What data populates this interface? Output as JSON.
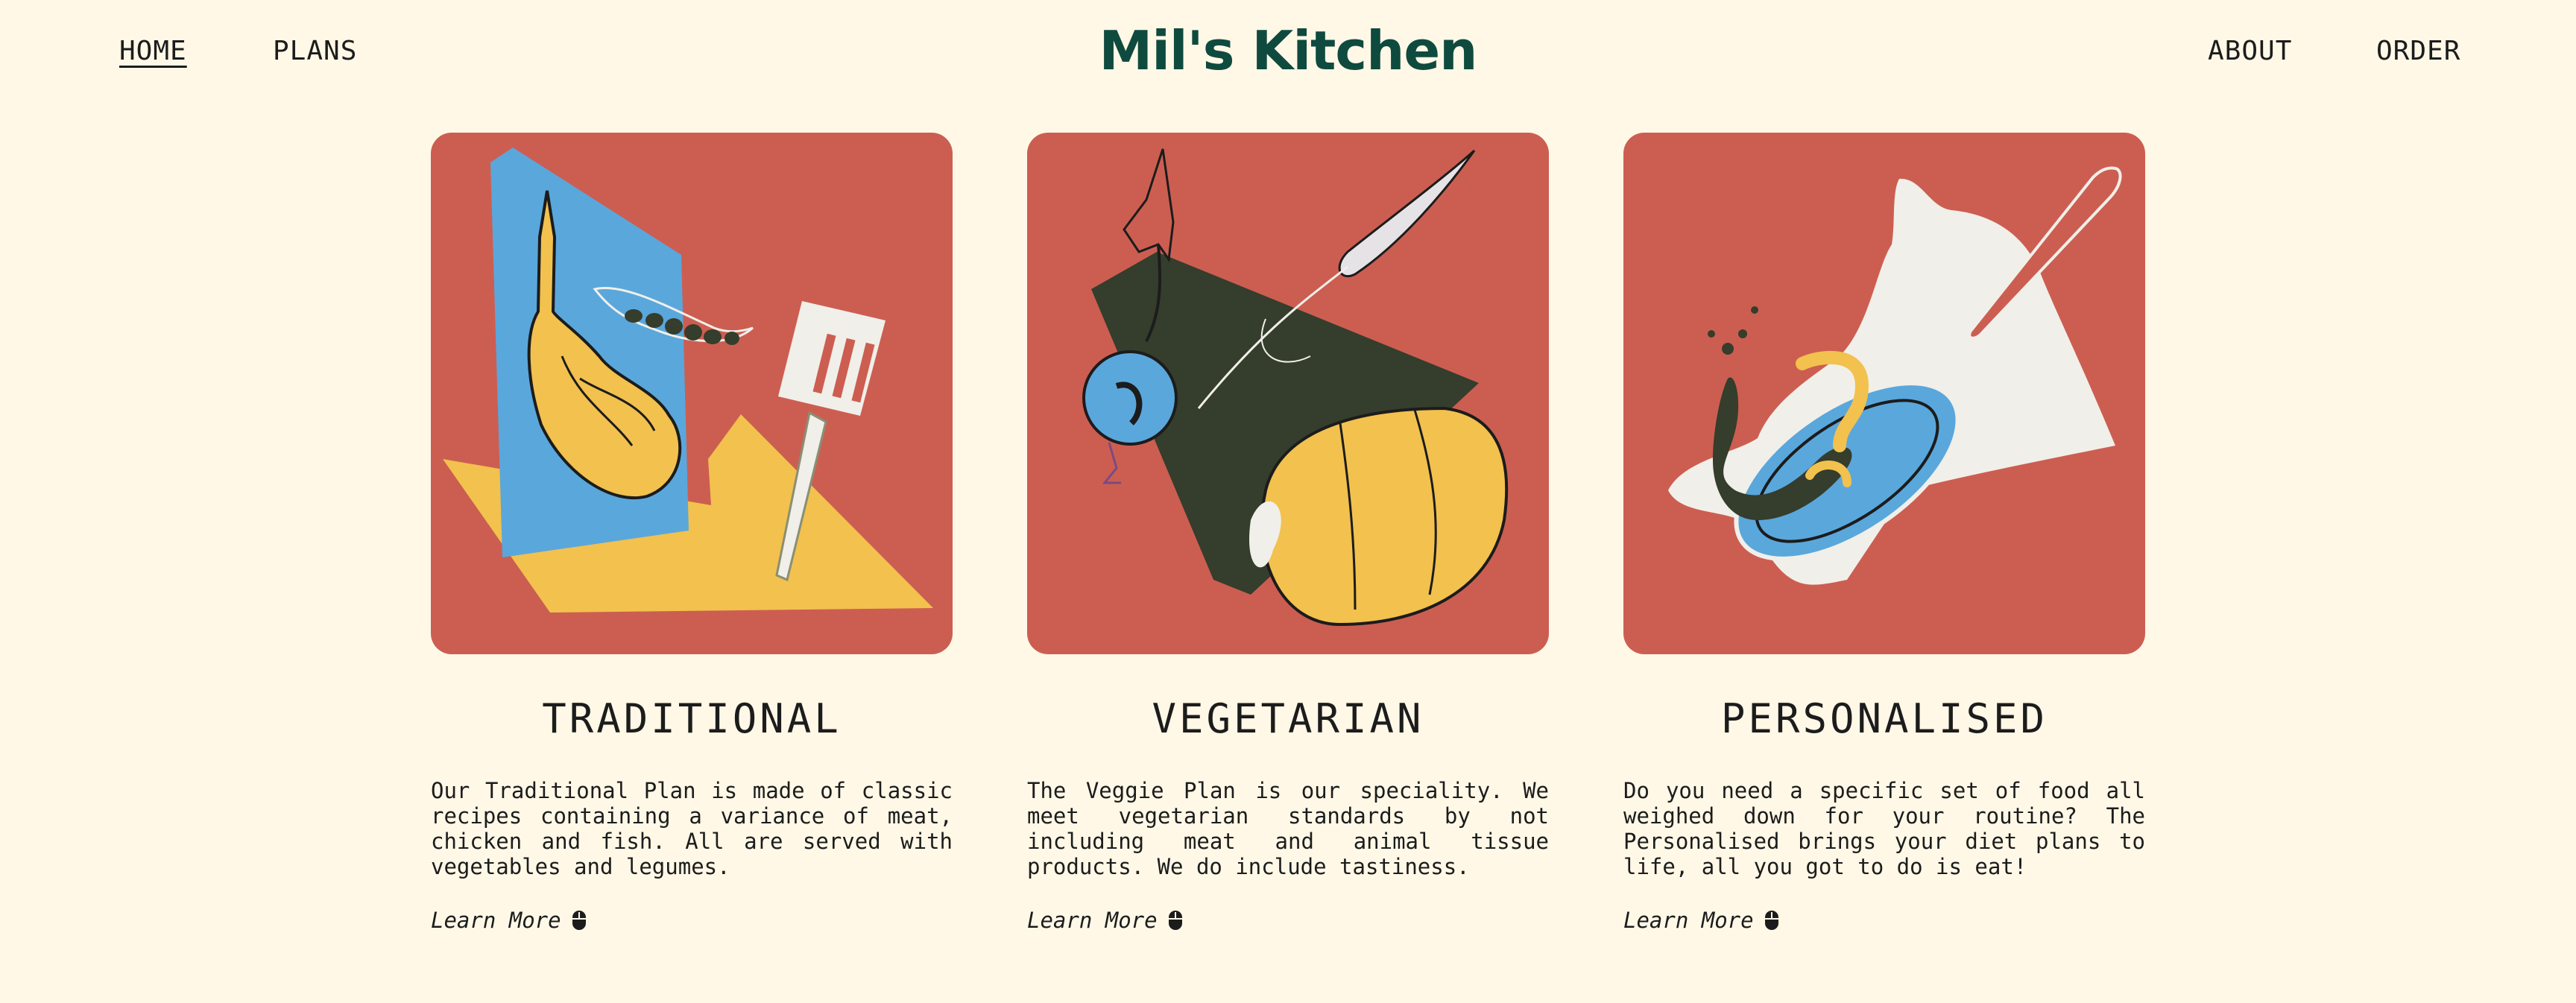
{
  "nav": {
    "left": [
      {
        "label": "HOME",
        "active": true
      },
      {
        "label": "PLANS",
        "active": false
      }
    ],
    "right": [
      {
        "label": "ABOUT"
      },
      {
        "label": "ORDER"
      }
    ]
  },
  "brand": "Mil's Kitchen",
  "colors": {
    "background": "#fff8e7",
    "card_red": "#cc5e51",
    "brand_green": "#0f4a3e",
    "blue": "#5aa7dc",
    "yellow": "#f2c14e",
    "dark_green": "#353d2c",
    "off_white": "#f1efe9"
  },
  "plans": [
    {
      "title": "TRADITIONAL",
      "description": "Our Traditional Plan is made of classic recipes containing a variance of meat, chicken and fish. All are served with vegetables and legumes.",
      "cta": "Learn More",
      "cta_icon": "mouse-icon",
      "illustration": "meat-peas-spatula-illustration"
    },
    {
      "title": "VEGETARIAN",
      "description": "The Veggie Plan is our speciality. We meet vegetarian standards by not including meat and animal tissue products. We do include tastiness.",
      "cta": "Learn More",
      "cta_icon": "mouse-icon",
      "illustration": "beet-carrot-pepper-illustration"
    },
    {
      "title": "PERSONALISED",
      "description": "Do you need a specific set of food all weighed down for your routine? The Personalised brings your diet plans to life, all you got to do is eat!",
      "cta": "Learn More",
      "cta_icon": "mouse-icon",
      "illustration": "frying-pan-illustration"
    }
  ]
}
